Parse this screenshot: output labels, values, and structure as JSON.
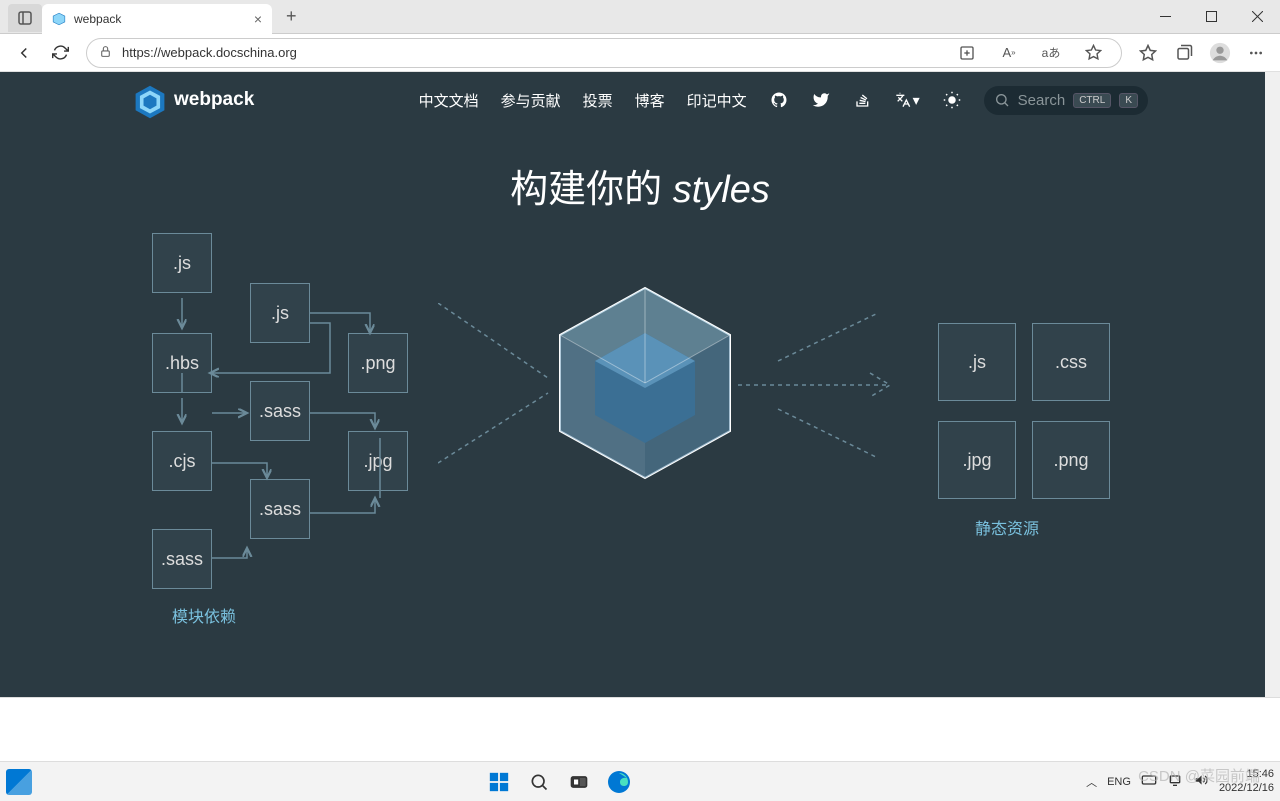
{
  "browser": {
    "tab_title": "webpack",
    "url": "https://webpack.docschina.org"
  },
  "header": {
    "logo_text": "webpack",
    "nav": [
      "中文文档",
      "参与贡献",
      "投票",
      "博客",
      "印记中文"
    ],
    "search_label": "Search",
    "kbd1": "CTRL",
    "kbd2": "K"
  },
  "hero": {
    "prefix": "构建你的 ",
    "accent": "styles"
  },
  "input_boxes": {
    "js1": ".js",
    "js2": ".js",
    "png": ".png",
    "hbs": ".hbs",
    "sass1": ".sass",
    "cjs": ".cjs",
    "jpg": ".jpg",
    "sass2": ".sass",
    "sass3": ".sass"
  },
  "output_boxes": {
    "js": ".js",
    "css": ".css",
    "jpg": ".jpg",
    "png": ".png"
  },
  "captions": {
    "left": "模块依赖",
    "right": "静态资源"
  },
  "taskbar": {
    "lang": "ENG",
    "time": "15:46",
    "date": "2022/12/16"
  },
  "watermark": "CSDN @菜园前端"
}
